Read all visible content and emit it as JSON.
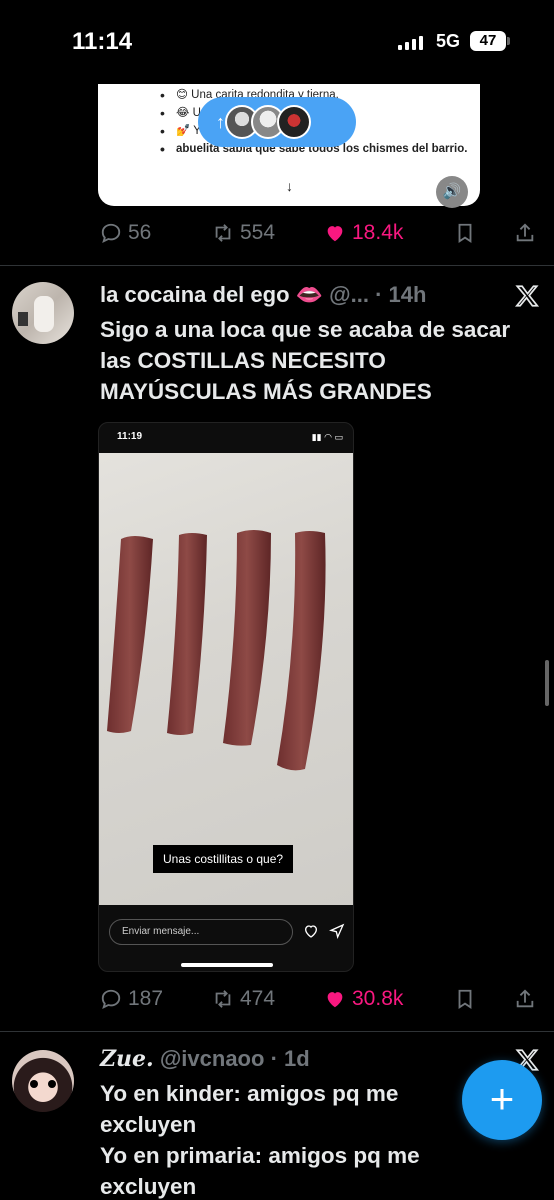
{
  "status_bar": {
    "time": "11:14",
    "network": "5G",
    "battery": "47"
  },
  "quoted_post": {
    "bullets": [
      "😊 Una carita redondita y tierna.",
      "😂 U                                         que no conv",
      "💅 Y ese                                    a vibra de"
    ],
    "last_line": "abuelita sabia que sabe todos los chismes del barrio.",
    "actions": {
      "replies": "56",
      "reposts": "554",
      "likes": "18.4k"
    }
  },
  "tweet1": {
    "name": "la cocaina del ego 👄",
    "handle": "@...",
    "time": "· 14h",
    "text": "Sigo a una loca que se acaba de sacar las COSTILLAS NECESITO MAYÚSCULAS MÁS GRANDES",
    "media": {
      "time": "11:19",
      "caption": "Unas costillitas o que?",
      "input_placeholder": "Enviar mensaje..."
    },
    "actions": {
      "replies": "187",
      "reposts": "474",
      "likes": "30.8k"
    }
  },
  "tweet2": {
    "name": "𝒁𝒖𝒆.",
    "handle": "@ivcnaoo",
    "time": "· 1d",
    "text": "Yo en kinder: amigos pq me excluyen\nYo en primaria: amigos pq me excluyen"
  },
  "colors": {
    "accent": "#1d9bf0",
    "like": "#f91880",
    "muted": "#71767b"
  }
}
